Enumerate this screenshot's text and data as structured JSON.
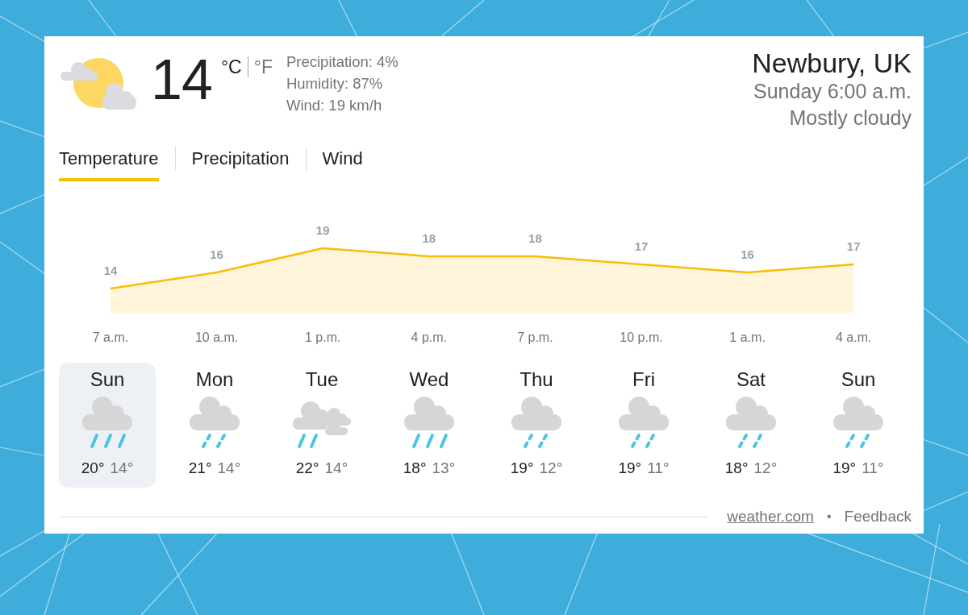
{
  "current": {
    "temperature": "14",
    "units": [
      {
        "label": "°C",
        "selected": true
      },
      {
        "label": "°F",
        "selected": false
      }
    ],
    "details": [
      "Precipitation: 4%",
      "Humidity: 87%",
      "Wind: 19 km/h"
    ]
  },
  "location": {
    "name": "Newbury, UK",
    "time": "Sunday 6:00 a.m.",
    "condition": "Mostly cloudy"
  },
  "tabs": [
    {
      "label": "Temperature",
      "selected": true
    },
    {
      "label": "Precipitation",
      "selected": false
    },
    {
      "label": "Wind",
      "selected": false
    }
  ],
  "chart": {
    "chart_data": {
      "type": "area",
      "categories": [
        "7 a.m.",
        "10 a.m.",
        "1 p.m.",
        "4 p.m.",
        "7 p.m.",
        "10 p.m.",
        "1 a.m.",
        "4 a.m."
      ],
      "series": [
        {
          "color": "#fbbc04",
          "values": [
            14,
            16,
            19,
            18,
            18,
            17,
            16,
            17
          ]
        }
      ],
      "data_labels": true
    }
  },
  "days": [
    {
      "name": "Sun",
      "kind": "heavy-rain",
      "high": "20°",
      "low": "14°",
      "selected": true
    },
    {
      "name": "Mon",
      "kind": "light-rain",
      "high": "21°",
      "low": "14°",
      "selected": false
    },
    {
      "name": "Tue",
      "kind": "cloudy-rain",
      "high": "22°",
      "low": "14°",
      "selected": false
    },
    {
      "name": "Wed",
      "kind": "heavy-rain",
      "high": "18°",
      "low": "13°",
      "selected": false
    },
    {
      "name": "Thu",
      "kind": "light-rain",
      "high": "19°",
      "low": "12°",
      "selected": false
    },
    {
      "name": "Fri",
      "kind": "light-rain",
      "high": "19°",
      "low": "11°",
      "selected": false
    },
    {
      "name": "Sat",
      "kind": "light-rain",
      "high": "18°",
      "low": "12°",
      "selected": false
    },
    {
      "name": "Sun",
      "kind": "light-rain",
      "high": "19°",
      "low": "11°",
      "selected": false
    }
  ],
  "footer": {
    "source_link": "weather.com",
    "separator": "•",
    "feedback_link": "Feedback"
  }
}
